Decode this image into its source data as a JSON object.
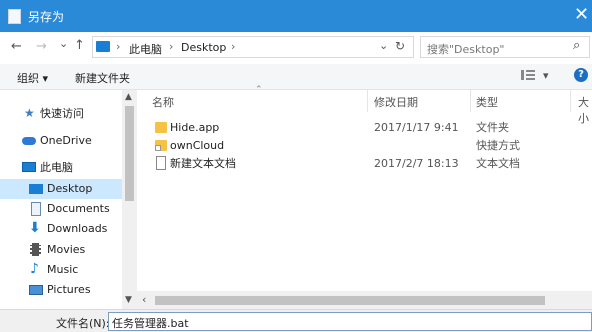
{
  "window": {
    "title": "另存为",
    "close_glyph": "✕"
  },
  "address": {
    "back": "←",
    "forward": "→",
    "history": "⌄",
    "up": "↑",
    "crumbs": [
      "此电脑",
      "Desktop"
    ],
    "sep": "›",
    "dropdown": "⌄",
    "refresh": "↻",
    "search_placeholder": "搜索\"Desktop\"",
    "search_icon": "⌕"
  },
  "toolbar": {
    "organize": "组织 ▾",
    "new_folder": "新建文件夹",
    "view": "▾",
    "help": "?"
  },
  "sidebar": {
    "items": [
      {
        "label": "快速访问",
        "icon": "star-icon"
      },
      {
        "label": "OneDrive",
        "icon": "cloud-icon"
      },
      {
        "label": "此电脑",
        "icon": "computer-icon"
      },
      {
        "label": "Desktop",
        "icon": "desktop-icon",
        "selected": true
      },
      {
        "label": "Documents",
        "icon": "documents-icon"
      },
      {
        "label": "Downloads",
        "icon": "downloads-icon"
      },
      {
        "label": "Movies",
        "icon": "movies-icon"
      },
      {
        "label": "Music",
        "icon": "music-icon"
      },
      {
        "label": "Pictures",
        "icon": "pictures-icon"
      }
    ]
  },
  "columns": {
    "name": "名称",
    "modified": "修改日期",
    "type": "类型",
    "size": "大小"
  },
  "files": [
    {
      "name": "Hide.app",
      "date": "2017/1/17 9:41",
      "type": "文件夹",
      "icon": "folder-icon"
    },
    {
      "name": "ownCloud",
      "date": "",
      "type": "快捷方式",
      "icon": "shortcut-icon"
    },
    {
      "name": "新建文本文档",
      "date": "2017/2/7 18:13",
      "type": "文本文档",
      "icon": "text-file-icon"
    }
  ],
  "footer": {
    "filename_label": "文件名(N):",
    "filename_value": "任务管理器.bat"
  },
  "colors": {
    "accent": "#2b8ad8",
    "selection": "#cce8ff",
    "folder": "#f5c244"
  }
}
